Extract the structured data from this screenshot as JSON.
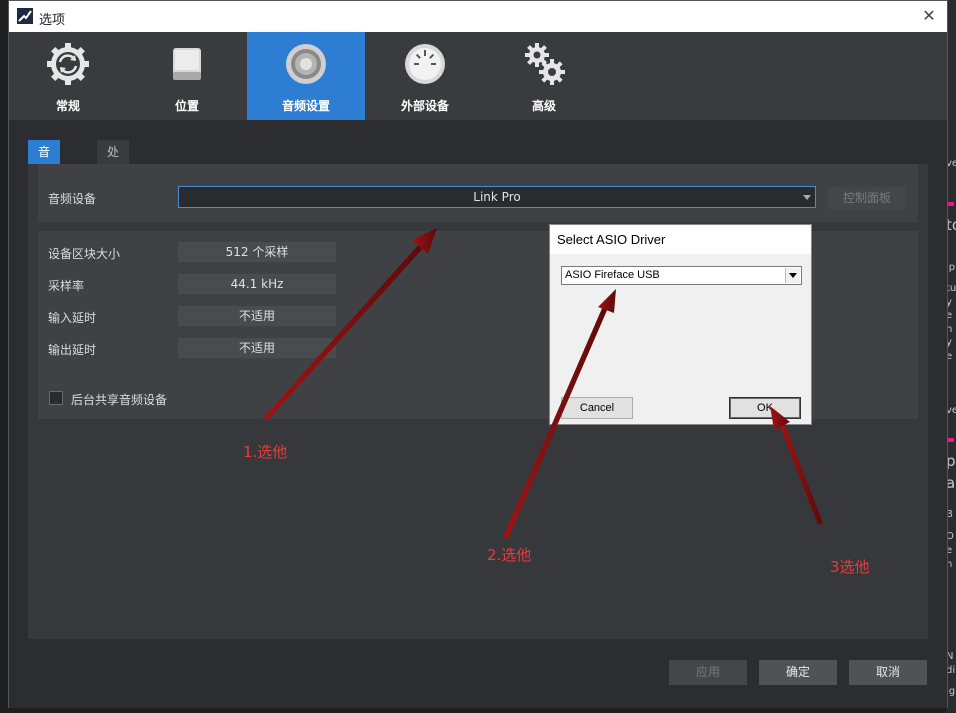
{
  "window": {
    "title": "选项",
    "close_glyph": "✕"
  },
  "toolbar": {
    "items": [
      {
        "label": "常规",
        "icon": "sync-gear-icon",
        "active": false
      },
      {
        "label": "位置",
        "icon": "drive-icon",
        "active": false
      },
      {
        "label": "音频设置",
        "icon": "speaker-icon",
        "active": true
      },
      {
        "label": "外部设备",
        "icon": "gauge-icon",
        "active": false
      },
      {
        "label": "高级",
        "icon": "gears-icon",
        "active": false
      }
    ]
  },
  "subtabs": [
    {
      "label": "音频设备",
      "active": true
    },
    {
      "label": "处理中",
      "active": false
    }
  ],
  "audio_device": {
    "label": "音频设备",
    "selected": "Link Pro",
    "control_panel_label": "控制面板"
  },
  "params": [
    {
      "label": "设备区块大小",
      "value": "512 个采样"
    },
    {
      "label": "采样率",
      "value": "44.1 kHz"
    },
    {
      "label": "输入延时",
      "value": "不适用"
    },
    {
      "label": "输出延时",
      "value": "不适用"
    }
  ],
  "background_share": {
    "label": "后台共享音频设备",
    "checked": false
  },
  "footer": {
    "apply": "应用",
    "ok": "确定",
    "cancel": "取消"
  },
  "asio_dialog": {
    "title": "Select ASIO Driver",
    "selected_driver": "ASIO Fireface USB",
    "cancel_label": "Cancel",
    "ok_label": "OK"
  },
  "annotations": {
    "step1": "1.选他",
    "step2": "2.选他",
    "step3": "3选他",
    "color": "#e83c3c",
    "arrow_color": "#7a0f0f"
  },
  "background_fragments": [
    "ve",
    "to",
    "ip",
    "tu",
    "y",
    "e",
    "n",
    "y",
    "e",
    "ve",
    "p",
    "a",
    "B",
    "O",
    "e",
    "n",
    "N",
    "di",
    "ig"
  ]
}
